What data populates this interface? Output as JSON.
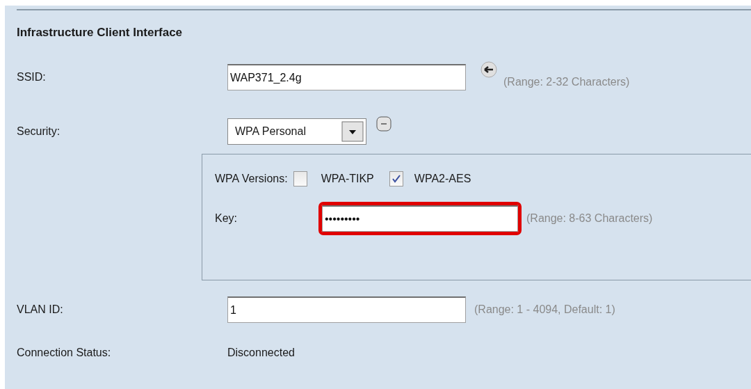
{
  "section_title": "Infrastructure Client Interface",
  "ssid": {
    "label": "SSID:",
    "value": "WAP371_2.4g",
    "hint": "(Range: 2-32 Characters)"
  },
  "security": {
    "label": "Security:",
    "value": "WPA Personal",
    "expanded": true
  },
  "wpa": {
    "label": "WPA Versions:",
    "versions": [
      {
        "label": "WPA-TIKP",
        "checked": false
      },
      {
        "label": "WPA2-AES",
        "checked": true
      }
    ],
    "key": {
      "label": "Key:",
      "value": "•••••••••",
      "highlighted": true,
      "hint": "(Range: 8-63 Characters)"
    }
  },
  "vlan": {
    "label": "VLAN ID:",
    "value": "1",
    "hint": "(Range: 1 - 4094, Default: 1)"
  },
  "connection_status": {
    "label": "Connection Status:",
    "value": "Disconnected"
  }
}
